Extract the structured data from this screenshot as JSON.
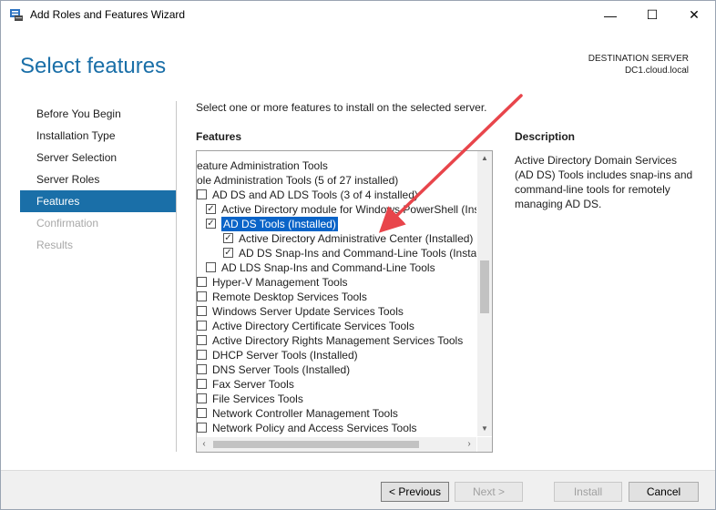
{
  "window": {
    "title": "Add Roles and Features Wizard",
    "minimize": "—",
    "maximize": "☐",
    "close": "✕"
  },
  "header": {
    "page_title": "Select features",
    "destination_label": "DESTINATION SERVER",
    "destination_server": "DC1.cloud.local"
  },
  "nav": {
    "items": [
      {
        "label": "Before You Begin",
        "state": "normal"
      },
      {
        "label": "Installation Type",
        "state": "normal"
      },
      {
        "label": "Server Selection",
        "state": "normal"
      },
      {
        "label": "Server Roles",
        "state": "normal"
      },
      {
        "label": "Features",
        "state": "active"
      },
      {
        "label": "Confirmation",
        "state": "disabled"
      },
      {
        "label": "Results",
        "state": "disabled"
      }
    ]
  },
  "main": {
    "instruction": "Select one or more features to install on the selected server.",
    "features_label": "Features",
    "tree": [
      {
        "label": "eature Administration Tools",
        "indent": 0,
        "checkbox": false,
        "checked": false,
        "selected": false
      },
      {
        "label": "ole Administration Tools (5 of 27 installed)",
        "indent": 0,
        "checkbox": false,
        "checked": false,
        "selected": false
      },
      {
        "label": "AD DS and AD LDS Tools (3 of 4 installed)",
        "indent": 1,
        "checkbox": "partial",
        "checked": false,
        "selected": false
      },
      {
        "label": "Active Directory module for Windows PowerShell (Ins",
        "indent": 2,
        "checkbox": true,
        "checked": true,
        "selected": false
      },
      {
        "label": "AD DS Tools (Installed)",
        "indent": 2,
        "checkbox": true,
        "checked": true,
        "selected": true
      },
      {
        "label": "Active Directory Administrative Center (Installed)",
        "indent": 3,
        "checkbox": true,
        "checked": true,
        "selected": false
      },
      {
        "label": "AD DS Snap-Ins and Command-Line Tools (Instal",
        "indent": 3,
        "checkbox": true,
        "checked": true,
        "selected": false
      },
      {
        "label": "AD LDS Snap-Ins and Command-Line Tools",
        "indent": 2,
        "checkbox": true,
        "checked": false,
        "selected": false
      },
      {
        "label": "Hyper-V Management Tools",
        "indent": 1,
        "checkbox": "partial",
        "checked": false,
        "selected": false
      },
      {
        "label": "Remote Desktop Services Tools",
        "indent": 1,
        "checkbox": "partial",
        "checked": false,
        "selected": false
      },
      {
        "label": "Windows Server Update Services Tools",
        "indent": 1,
        "checkbox": "partial",
        "checked": false,
        "selected": false
      },
      {
        "label": "Active Directory Certificate Services Tools",
        "indent": 1,
        "checkbox": "partial",
        "checked": false,
        "selected": false
      },
      {
        "label": "Active Directory Rights Management Services Tools",
        "indent": 1,
        "checkbox": "partial",
        "checked": false,
        "selected": false
      },
      {
        "label": "DHCP Server Tools (Installed)",
        "indent": 1,
        "checkbox": "partial",
        "checked": false,
        "selected": false
      },
      {
        "label": "DNS Server Tools (Installed)",
        "indent": 1,
        "checkbox": "partial",
        "checked": false,
        "selected": false
      },
      {
        "label": "Fax Server Tools",
        "indent": 1,
        "checkbox": "partial",
        "checked": false,
        "selected": false
      },
      {
        "label": "File Services Tools",
        "indent": 1,
        "checkbox": "partial",
        "checked": false,
        "selected": false
      },
      {
        "label": "Network Controller Management Tools",
        "indent": 1,
        "checkbox": "partial",
        "checked": false,
        "selected": false
      },
      {
        "label": "Network Policy and Access Services Tools",
        "indent": 1,
        "checkbox": "partial",
        "checked": false,
        "selected": false
      }
    ]
  },
  "description": {
    "title": "Description",
    "text": "Active Directory Domain Services (AD DS) Tools includes snap-ins and command-line tools for remotely managing AD DS."
  },
  "footer": {
    "previous": "< Previous",
    "next": "Next >",
    "install": "Install",
    "cancel": "Cancel"
  },
  "colors": {
    "accent": "#1a6fa8",
    "selection": "#0a64c8",
    "annotation_arrow": "#e8454b"
  }
}
